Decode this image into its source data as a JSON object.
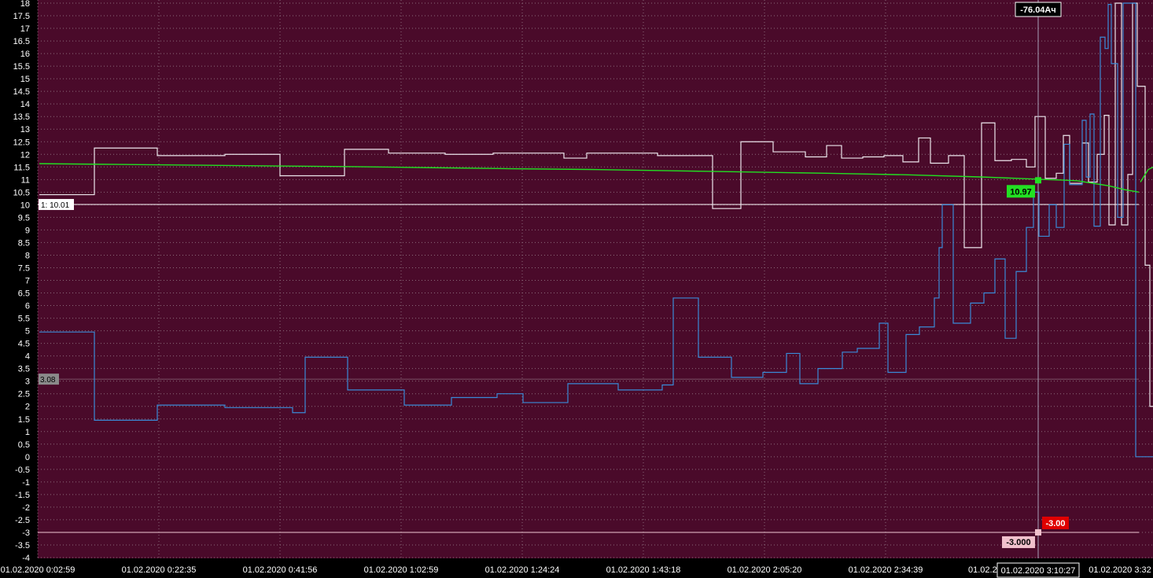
{
  "chart_data": {
    "type": "line",
    "ylim": [
      -4,
      18
    ],
    "y_tick_step": 0.5,
    "grid": true,
    "colors": {
      "background": "#4a0a2a",
      "frame": "#000000",
      "grid": "#8a6a7a",
      "axis_text": "#ffffff",
      "white_series": "#ece6ec",
      "blue_series": "#3a8ad6",
      "green_series": "#22e022",
      "hline": "#ffffff",
      "lower_hline": "#f0c8d4",
      "crosshair": "#a8a0b8"
    },
    "x_tick_labels": [
      "01.02.2020 0:02:59",
      "01.02.2020 0:22:35",
      "01.02.2020 0:41:56",
      "01.02.2020 1:02:59",
      "01.02.2020 1:24:24",
      "01.02.2020 1:43:18",
      "01.02.2020 2:05:20",
      "01.02.2020 2:34:39",
      "01.02.2020 3:10:27",
      "01.02.2020 3:32"
    ],
    "x_tick_partial": "01.02.2020",
    "series": [
      {
        "id": "white",
        "style": "step",
        "x": [
          0,
          70,
          150,
          236,
          306,
          388,
          444,
          516,
          577,
          667,
          696,
          786,
          856,
          892,
          933,
          974,
          1001,
          1020,
          1047,
          1074,
          1098,
          1118,
          1133,
          1156,
          1176,
          1198,
          1215,
          1236,
          1255,
          1266,
          1279,
          1293,
          1302,
          1310,
          1326,
          1334,
          1345,
          1354,
          1360,
          1368,
          1376,
          1384,
          1390,
          1396,
          1406,
          1412,
          1418,
          1422,
          1434,
          1438,
          1446
        ],
        "y": [
          10.4,
          12.25,
          11.95,
          12.0,
          11.15,
          12.2,
          12.05,
          12.0,
          12.05,
          11.85,
          12.05,
          11.95,
          9.85,
          12.5,
          12.1,
          11.9,
          12.35,
          11.85,
          11.9,
          11.95,
          11.7,
          12.65,
          11.65,
          11.95,
          8.3,
          13.25,
          11.75,
          11.8,
          11.5,
          13.5,
          11.05,
          11.25,
          12.75,
          10.85,
          12.45,
          10.9,
          12.0,
          13.55,
          9.2,
          18.0,
          9.2,
          11.2,
          18.0,
          14.7,
          7.6,
          2.0,
          18.0,
          2.0,
          12.0,
          2.0,
          12.0
        ],
        "x_end": 1466
      },
      {
        "id": "blue",
        "style": "step",
        "x": [
          0,
          70,
          150,
          236,
          322,
          338,
          392,
          464,
          524,
          582,
          615,
          672,
          736,
          792,
          806,
          838,
          880,
          920,
          950,
          967,
          990,
          1021,
          1040,
          1068,
          1079,
          1102,
          1119,
          1138,
          1144,
          1148,
          1162,
          1184,
          1201,
          1215,
          1228,
          1242,
          1255,
          1264,
          1271,
          1284,
          1293,
          1303,
          1310,
          1326,
          1331,
          1336,
          1341,
          1349,
          1355,
          1359,
          1363,
          1371,
          1378,
          1384,
          1394,
          1398
        ],
        "y": [
          4.95,
          1.45,
          2.05,
          1.95,
          1.75,
          3.95,
          2.65,
          2.05,
          2.35,
          2.5,
          2.15,
          2.9,
          2.65,
          2.85,
          6.3,
          3.95,
          3.15,
          3.35,
          4.1,
          2.9,
          3.5,
          4.15,
          4.3,
          5.3,
          3.35,
          4.85,
          5.15,
          6.3,
          8.3,
          10.0,
          5.3,
          6.1,
          6.5,
          7.85,
          4.7,
          7.35,
          9.1,
          10.5,
          8.75,
          10.0,
          9.1,
          12.4,
          10.8,
          13.35,
          11.1,
          13.6,
          9.15,
          16.65,
          16.2,
          17.95,
          15.6,
          9.5,
          18.0,
          18.0,
          0.0,
          0.0
        ],
        "x_end": 1466
      },
      {
        "id": "green",
        "style": "smooth",
        "x": [
          0,
          100,
          200,
          300,
          400,
          500,
          600,
          700,
          800,
          900,
          1000,
          1100,
          1200,
          1250,
          1280,
          1300,
          1320,
          1340,
          1360,
          1380,
          1398
        ],
        "y": [
          11.63,
          11.6,
          11.57,
          11.54,
          11.51,
          11.47,
          11.43,
          11.4,
          11.35,
          11.3,
          11.25,
          11.19,
          11.1,
          11.04,
          11.0,
          10.98,
          10.95,
          10.85,
          10.75,
          10.6,
          10.5
        ],
        "tail": [
          {
            "x": 1400,
            "y": 10.9
          },
          {
            "x": 1410,
            "y": 11.4
          },
          {
            "x": 1418,
            "y": 11.52
          }
        ]
      }
    ],
    "horizontal_lines": [
      {
        "id": "hline-10",
        "y": 10.01,
        "label": "1: 10.01"
      },
      {
        "id": "hline-3",
        "y": 3.08,
        "label": "3.08"
      },
      {
        "id": "hline-minus3",
        "y": -3.0,
        "label": "-3.000"
      }
    ],
    "markers": {
      "green_point": {
        "x": 1270,
        "y": 10.97,
        "label": "10.97"
      },
      "pink_point": {
        "x": 1270,
        "y": -3.0,
        "label": "-3.00"
      }
    },
    "crosshair": {
      "x": 1270,
      "top_label": "-76.04Ач",
      "bottom_label": "01.02.2020 3:10:27"
    }
  }
}
